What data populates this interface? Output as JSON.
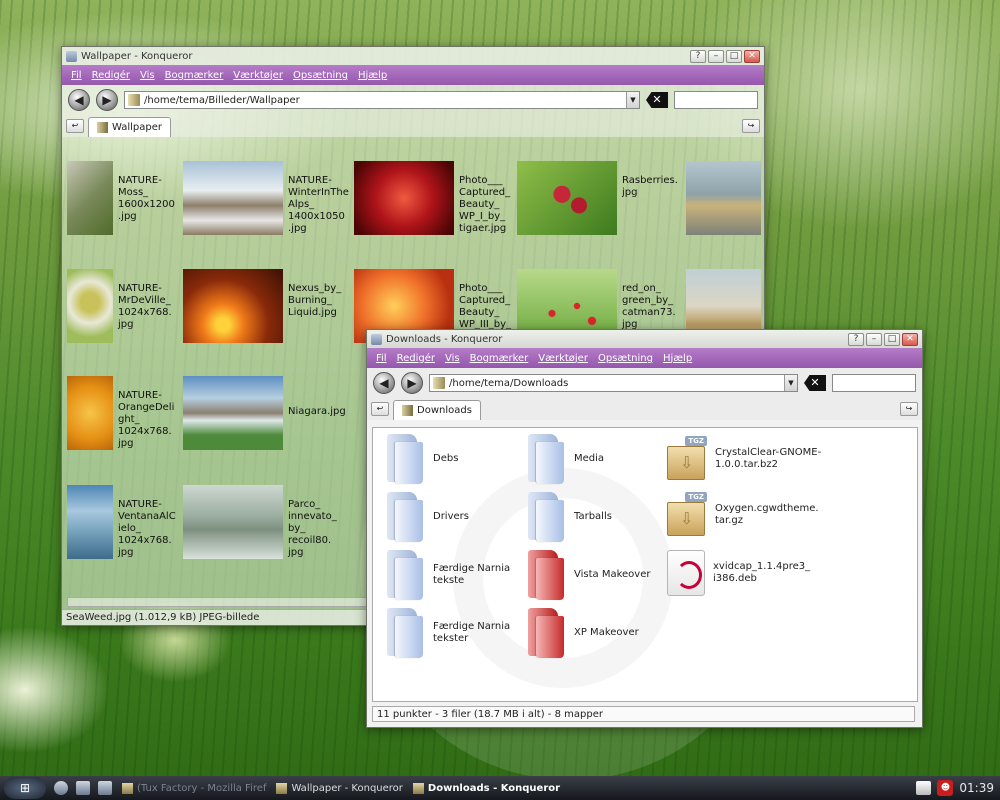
{
  "windows": [
    {
      "title": "Wallpaper - Konqueror",
      "menu": [
        "Fil",
        "Redigér",
        "Vis",
        "Bogmærker",
        "Værktøjer",
        "Opsætning",
        "Hjælp"
      ],
      "address": "/home/tema/Billeder/Wallpaper",
      "tab": "Wallpaper",
      "files": [
        {
          "name": "NATURE-\nMoss_\n1600x1200\n.jpg",
          "icon": "moss-thumbnail"
        },
        {
          "name": "NATURE-\nWinterInThe\nAlps_\n1400x1050\n.jpg",
          "icon": "alps-thumbnail"
        },
        {
          "name": "Photo___\nCaptured_\nBeauty_\nWP_I_by_\ntigaer.jpg",
          "icon": "rose-thumbnail"
        },
        {
          "name": "Rasberries.\njpg",
          "icon": "raspberries-thumbnail"
        },
        {
          "name": "",
          "icon": "seaweed-thumbnail"
        },
        {
          "name": "NATURE-\nMrDeVille_\n1024x768.\njpg",
          "icon": "flower-thumbnail"
        },
        {
          "name": "Nexus_by_\nBurning_\nLiquid.jpg",
          "icon": "sunset-thumbnail"
        },
        {
          "name": "Photo___\nCaptured_\nBeauty_\nWP_III_by_\ntigaer.jpg",
          "icon": "orange-flower-thumbnail"
        },
        {
          "name": "red_on_\ngreen_by_\ncatman73.\njpg",
          "icon": "poppies-thumbnail"
        },
        {
          "name": "",
          "icon": "beach-rock-thumbnail"
        },
        {
          "name": "NATURE-\nOrangeDeli\nght_\n1024x768.\njpg",
          "icon": "orange-thumbnail"
        },
        {
          "name": "Niagara.jpg",
          "icon": "waterfall-thumbnail"
        },
        {
          "name": "NATURE-\nVentanaAlC\nielo_\n1024x768.\njpg",
          "icon": "sky-thumbnail"
        },
        {
          "name": "Parco_\ninnevato_\nby_\nrecoil80.\njpg",
          "icon": "snow-park-thumbnail"
        }
      ],
      "status": "SeaWeed.jpg (1.012,9 kB)  JPEG-billede"
    },
    {
      "title": "Downloads - Konqueror",
      "menu": [
        "Fil",
        "Redigér",
        "Vis",
        "Bogmærker",
        "Værktøjer",
        "Opsætning",
        "Hjælp"
      ],
      "address": "/home/tema/Downloads",
      "tab": "Downloads",
      "items": [
        {
          "name": "Debs",
          "icon": "folder-icon"
        },
        {
          "name": "Media",
          "icon": "folder-icon"
        },
        {
          "name": "CrystalClear-GNOME-\n1.0.0.tar.bz2",
          "icon": "tgz-archive-icon"
        },
        {
          "name": "Drivers",
          "icon": "folder-icon"
        },
        {
          "name": "Tarballs",
          "icon": "folder-icon"
        },
        {
          "name": "Oxygen.cgwdtheme.\ntar.gz",
          "icon": "tgz-archive-icon"
        },
        {
          "name": "Færdige Narnia\ntekste",
          "icon": "folder-icon"
        },
        {
          "name": "Vista Makeover",
          "icon": "red-folder-icon"
        },
        {
          "name": "xvidcap_1.1.4pre3_\ni386.deb",
          "icon": "debian-package-icon"
        },
        {
          "name": "Færdige Narnia\ntekster",
          "icon": "folder-icon"
        },
        {
          "name": "XP Makeover",
          "icon": "red-folder-icon"
        }
      ],
      "status": "11 punkter - 3 filer (18.7 MB i alt) - 8 mapper"
    }
  ],
  "taskbar": {
    "tasks": [
      "(Tux Factory - Mozilla Firef",
      "Wallpaper - Konqueror",
      "Downloads - Konqueror"
    ],
    "clock": "01:39"
  },
  "colors": {
    "menubar": "#9c5fb5",
    "accent": "#c70036"
  }
}
